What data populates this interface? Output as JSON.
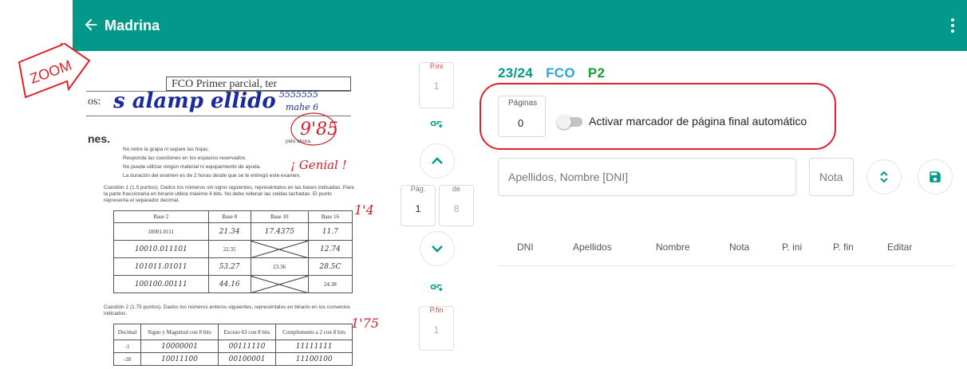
{
  "appbar": {
    "title": "Madrina",
    "back_icon": "arrow-left-icon",
    "menu_icon": "more-vert-icon",
    "color": "#03998a"
  },
  "zoom_badge": {
    "text": "ZOOM",
    "color": "#e0202a"
  },
  "document": {
    "header": "FCO Primer parcial, ter",
    "name_label": "os:",
    "name_handwritten": "s alamp ellido",
    "dni_handwritten": "5555555",
    "name2_handwritten": "mahe 6",
    "grade_handwritten": "9'85",
    "comment_handwritten": "¡ Genial !",
    "section_title": "nes.",
    "instructions_tail": "pido ahora.",
    "instructions": [
      "No retire la grapa ni separe las hojas.",
      "Responda las cuestiones en los espacios reservados.",
      "No puede utilizar ningún material ni equipamiento de ayuda.",
      "La duración del examen es de 2 horas desde que se le entregó este examen."
    ],
    "q1": {
      "text": "Cuestión 1 (1.5 puntos). Dados los números sin signo siguientes, represéntalos en las bases indicadas. Para la parte fraccionaria en binario utilice máximo 6 bits. No debe rellenar las celdas tachadas. El punto representa el separador decimal.",
      "score": "1'4",
      "headers": [
        "Base 2",
        "Base 8",
        "Base 10",
        "Base 16"
      ],
      "rows": [
        [
          "10001.0111",
          "21.34",
          "17.4375",
          "11.7"
        ],
        [
          "10010.011101",
          "22.35",
          "",
          "12.74"
        ],
        [
          "101011.01011",
          "53.27",
          "23.36",
          "28.5C"
        ],
        [
          "100100.00111",
          "44.16",
          "",
          "24.38"
        ]
      ]
    },
    "q2": {
      "text": "Cuestión 2 (1.75 puntos). Dados los números enteros siguientes, represéntalos en binario en los convenios indicados.",
      "score": "1'75",
      "headers": [
        "Decimal",
        "Signo y Magnitud con 8 bits",
        "Exceso 63 con 8 bits",
        "Complemento a 2 con 8 bits"
      ],
      "rows": [
        [
          "-1",
          "10000001",
          "00111110",
          "11111111"
        ],
        [
          "-28",
          "10011100",
          "00100001",
          "11100100"
        ]
      ]
    }
  },
  "nav": {
    "pini_label": "P.ini",
    "pini_value": "1",
    "pag_label": "Pág.",
    "pag_value": "1",
    "de_label": "de",
    "de_value": "8",
    "pfin_label": "P.fin",
    "pfin_value": "1",
    "link_icon": "link-add-icon",
    "up_icon": "chevron-up-icon",
    "down_icon": "chevron-down-icon"
  },
  "breadcrumb": [
    {
      "text": "23/24",
      "color": "#03998a"
    },
    {
      "text": "FCO",
      "color": "#29a6d8"
    },
    {
      "text": "P2",
      "color": "#1d9a3a"
    }
  ],
  "paginas": {
    "label": "Páginas",
    "value": "0"
  },
  "auto_marker": {
    "label": "Activar marcador de página final automático",
    "enabled": false
  },
  "search": {
    "placeholder": "Apellidos, Nombre [DNI]"
  },
  "nota": {
    "placeholder": "Nota"
  },
  "table": {
    "headers": [
      "DNI",
      "Apellidos",
      "Nombre",
      "Nota",
      "P. ini",
      "P. fin",
      "Editar"
    ]
  }
}
